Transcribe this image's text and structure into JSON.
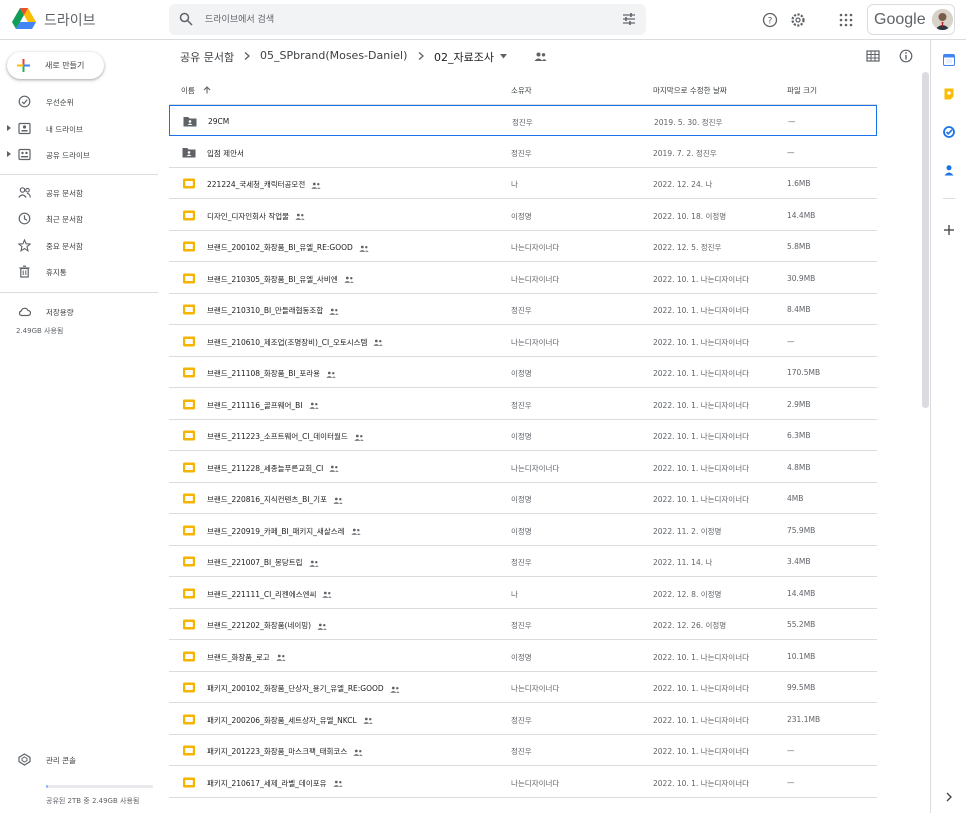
{
  "header": {
    "app_name": "드라이브",
    "search_placeholder": "드라이브에서 검색",
    "brand": "Google",
    "icons": [
      "help-icon",
      "settings-icon",
      "apps-grid-icon"
    ]
  },
  "sidebar": {
    "new_label": "새로 만들기",
    "items": [
      {
        "label": "우선순위",
        "icon": "priority-icon"
      },
      {
        "label": "내 드라이브",
        "icon": "my-drive-icon"
      },
      {
        "label": "공유 드라이브",
        "icon": "shared-drives-icon"
      },
      {
        "label": "공유 문서함",
        "icon": "shared-with-me-icon"
      },
      {
        "label": "최근 문서함",
        "icon": "recent-icon"
      },
      {
        "label": "중요 문서함",
        "icon": "starred-icon"
      },
      {
        "label": "휴지통",
        "icon": "trash-icon"
      },
      {
        "label": "저장용량",
        "icon": "cloud-icon"
      },
      {
        "label": "관리 콘솔",
        "icon": "admin-console-icon"
      }
    ],
    "storage_used": "2.49GB 사용됨",
    "storage_footer": "공유된 2TB 중 2.49GB 사용됨",
    "storage_fraction": 0.0012
  },
  "breadcrumb": {
    "items": [
      "공유 문서함",
      "05_SPbrand(Moses-Daniel)",
      "02_자료조사"
    ]
  },
  "table": {
    "columns": [
      "이름",
      "소유자",
      "마지막으로 수정한 날짜",
      "파일 크기"
    ],
    "rows": [
      {
        "name": "29CM",
        "owner": "정진우",
        "modified": "2019. 5. 30. 정진우",
        "size": "—",
        "type": "shared-folder",
        "shared": false
      },
      {
        "name": "입점 제안서",
        "owner": "정진우",
        "modified": "2019. 7. 2. 정진우",
        "size": "—",
        "type": "shared-folder",
        "shared": false
      },
      {
        "name": "221224_국세청_캐릭터공모전",
        "owner": "나",
        "modified": "2022. 12. 24. 나",
        "size": "1.6MB",
        "type": "slides",
        "shared": true
      },
      {
        "name": "디자인_디자인회사 작업물",
        "owner": "이정명",
        "modified": "2022. 10. 18. 이정명",
        "size": "14.4MB",
        "type": "slides",
        "shared": true
      },
      {
        "name": "브랜드_200102_화장품_BI_유엘_RE:GOOD",
        "owner": "나는디자이너다",
        "modified": "2022. 12. 5. 정진우",
        "size": "5.8MB",
        "type": "slides",
        "shared": true
      },
      {
        "name": "브랜드_210305_화장품_BI_유엘_사비엔",
        "owner": "나는디자이너다",
        "modified": "2022. 10. 1. 나는디자이너다",
        "size": "30.9MB",
        "type": "slides",
        "shared": true
      },
      {
        "name": "브랜드_210310_BI_만들래협동조합",
        "owner": "정진우",
        "modified": "2022. 10. 1. 나는디자이너다",
        "size": "8.4MB",
        "type": "slides",
        "shared": true
      },
      {
        "name": "브랜드_210610_제조업(조명장비)_CI_오토시스템",
        "owner": "나는디자이너다",
        "modified": "2022. 10. 1. 나는디자이너다",
        "size": "—",
        "type": "slides",
        "shared": true
      },
      {
        "name": "브랜드_211108_화장품_BI_포라용",
        "owner": "이정명",
        "modified": "2022. 10. 1. 나는디자이너다",
        "size": "170.5MB",
        "type": "slides",
        "shared": true
      },
      {
        "name": "브랜드_211116_골프웨어_BI",
        "owner": "정진우",
        "modified": "2022. 10. 1. 나는디자이너다",
        "size": "2.9MB",
        "type": "slides",
        "shared": true
      },
      {
        "name": "브랜드_211223_소프트웨어_CI_데이터월드",
        "owner": "이정명",
        "modified": "2022. 10. 1. 나는디자이너다",
        "size": "6.3MB",
        "type": "slides",
        "shared": true
      },
      {
        "name": "브랜드_211228_세종늘푸른교회_CI",
        "owner": "나는디자이너다",
        "modified": "2022. 10. 1. 나는디자이너다",
        "size": "4.8MB",
        "type": "slides",
        "shared": true
      },
      {
        "name": "브랜드_220816_지식컨텐츠_BI_기포",
        "owner": "이정명",
        "modified": "2022. 10. 1. 나는디자이너다",
        "size": "4MB",
        "type": "slides",
        "shared": true
      },
      {
        "name": "브랜드_220919_카페_BI_패키지_새살스레",
        "owner": "이정명",
        "modified": "2022. 11. 2. 이정명",
        "size": "75.9MB",
        "type": "slides",
        "shared": true
      },
      {
        "name": "브랜드_221007_BI_몽당트립",
        "owner": "정진우",
        "modified": "2022. 11. 14. 나",
        "size": "3.4MB",
        "type": "slides",
        "shared": true
      },
      {
        "name": "브랜드_221111_CI_리젠에스엔씨",
        "owner": "나",
        "modified": "2022. 12. 8. 이정명",
        "size": "14.4MB",
        "type": "slides",
        "shared": true
      },
      {
        "name": "브랜드_221202_화장품(네이밍)",
        "owner": "정진우",
        "modified": "2022. 12. 26. 이정명",
        "size": "55.2MB",
        "type": "slides",
        "shared": true
      },
      {
        "name": "브랜드_화장품_로고",
        "owner": "이정명",
        "modified": "2022. 10. 1. 나는디자이너다",
        "size": "10.1MB",
        "type": "slides",
        "shared": true
      },
      {
        "name": "패키지_200102_화장품_단상자_용기_유엘_RE:GOOD",
        "owner": "나는디자이너다",
        "modified": "2022. 10. 1. 나는디자이너다",
        "size": "99.5MB",
        "type": "slides",
        "shared": true
      },
      {
        "name": "패키지_200206_화장품_세트상자_유엘_NKCL",
        "owner": "정진우",
        "modified": "2022. 10. 1. 나는디자이너다",
        "size": "231.1MB",
        "type": "slides",
        "shared": true
      },
      {
        "name": "패키지_201223_화장품_마스크팩_태회코스",
        "owner": "정진우",
        "modified": "2022. 10. 1. 나는디자이너다",
        "size": "—",
        "type": "slides",
        "shared": true
      },
      {
        "name": "패키지_210617_세제_라벨_데이포유",
        "owner": "나는디자이너다",
        "modified": "2022. 10. 1. 나는디자이너다",
        "size": "—",
        "type": "slides",
        "shared": true
      }
    ]
  },
  "right_rail": [
    "calendar-icon",
    "keep-icon",
    "tasks-icon",
    "contacts-icon",
    "add-icon",
    "expand-icon"
  ],
  "colors": {
    "accent": "#1a73e8",
    "slides_yellow": "#f4b400",
    "folder_dark": "#5f6368"
  }
}
